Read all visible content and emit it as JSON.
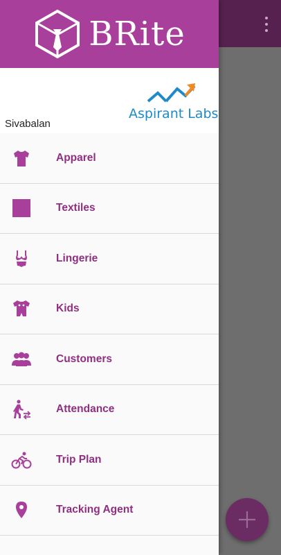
{
  "app": {
    "title": "BRite"
  },
  "toolbar": {
    "overflow_icon": "more-vert-icon"
  },
  "drawer": {
    "user_name": "Sivabalan",
    "partner_logo_text": "Aspirant Labs",
    "menu": [
      {
        "label": "Apparel",
        "icon": "tshirt-icon"
      },
      {
        "label": "Textiles",
        "icon": "square-icon"
      },
      {
        "label": "Lingerie",
        "icon": "lingerie-icon"
      },
      {
        "label": "Kids",
        "icon": "kids-icon"
      },
      {
        "label": "Customers",
        "icon": "group-icon"
      },
      {
        "label": "Attendance",
        "icon": "walking-icon"
      },
      {
        "label": "Trip Plan",
        "icon": "bike-icon"
      },
      {
        "label": "Tracking Agent",
        "icon": "location-pin-icon"
      }
    ]
  },
  "fab": {
    "icon": "plus-icon"
  },
  "colors": {
    "brand": "#a8409b",
    "menu_text": "#8f2f82",
    "toolbar": "#57214f",
    "partner_blue": "#1f8ac9",
    "partner_orange": "#f08a24"
  }
}
